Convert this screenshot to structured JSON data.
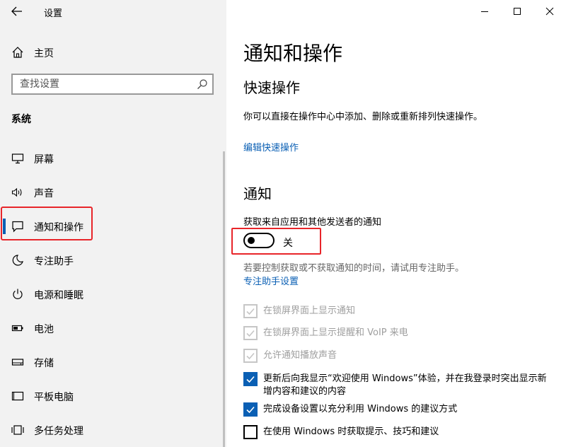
{
  "window": {
    "title": "设置"
  },
  "sidebar": {
    "home_label": "主页",
    "search_placeholder": "查找设置",
    "section_title": "系统",
    "items": [
      {
        "label": "屏幕",
        "icon": "monitor-icon"
      },
      {
        "label": "声音",
        "icon": "speaker-icon"
      },
      {
        "label": "通知和操作",
        "icon": "notification-icon",
        "active": true
      },
      {
        "label": "专注助手",
        "icon": "moon-icon"
      },
      {
        "label": "电源和睡眠",
        "icon": "power-icon"
      },
      {
        "label": "电池",
        "icon": "battery-icon"
      },
      {
        "label": "存储",
        "icon": "storage-icon"
      },
      {
        "label": "平板电脑",
        "icon": "tablet-icon"
      },
      {
        "label": "多任务处理",
        "icon": "multitask-icon"
      }
    ]
  },
  "main": {
    "title": "通知和操作",
    "quick_actions": {
      "heading": "快速操作",
      "description": "你可以直接在操作中心中添加、删除或重新排列快速操作。",
      "edit_link": "编辑快速操作"
    },
    "notifications": {
      "heading": "通知",
      "toggle_label": "获取来自应用和其他发送者的通知",
      "toggle_state": "关",
      "toggle_on": false,
      "focus_hint": "若要控制获取或不获取通知的时间，请试用专注助手。",
      "focus_link": "专注助手设置",
      "options": [
        {
          "label": "在锁屏界面上显示通知",
          "checked": true,
          "disabled": true
        },
        {
          "label": "在锁屏界面上显示提醒和 VoIP 来电",
          "checked": true,
          "disabled": true
        },
        {
          "label": "允许通知播放声音",
          "checked": true,
          "disabled": true
        },
        {
          "label": "更新后向我显示“欢迎使用 Windows”体验，并在我登录时突出显示新增内容和建议的内容",
          "checked": true,
          "disabled": false
        },
        {
          "label": "完成设备设置以充分利用 Windows 的建议方式",
          "checked": true,
          "disabled": false
        },
        {
          "label": "在使用 Windows 时获取提示、技巧和建议",
          "checked": false,
          "disabled": false
        }
      ]
    }
  },
  "colors": {
    "accent": "#0a5fb4",
    "highlight": "#e8252a",
    "sidebar_bg": "#f2f2f2"
  }
}
